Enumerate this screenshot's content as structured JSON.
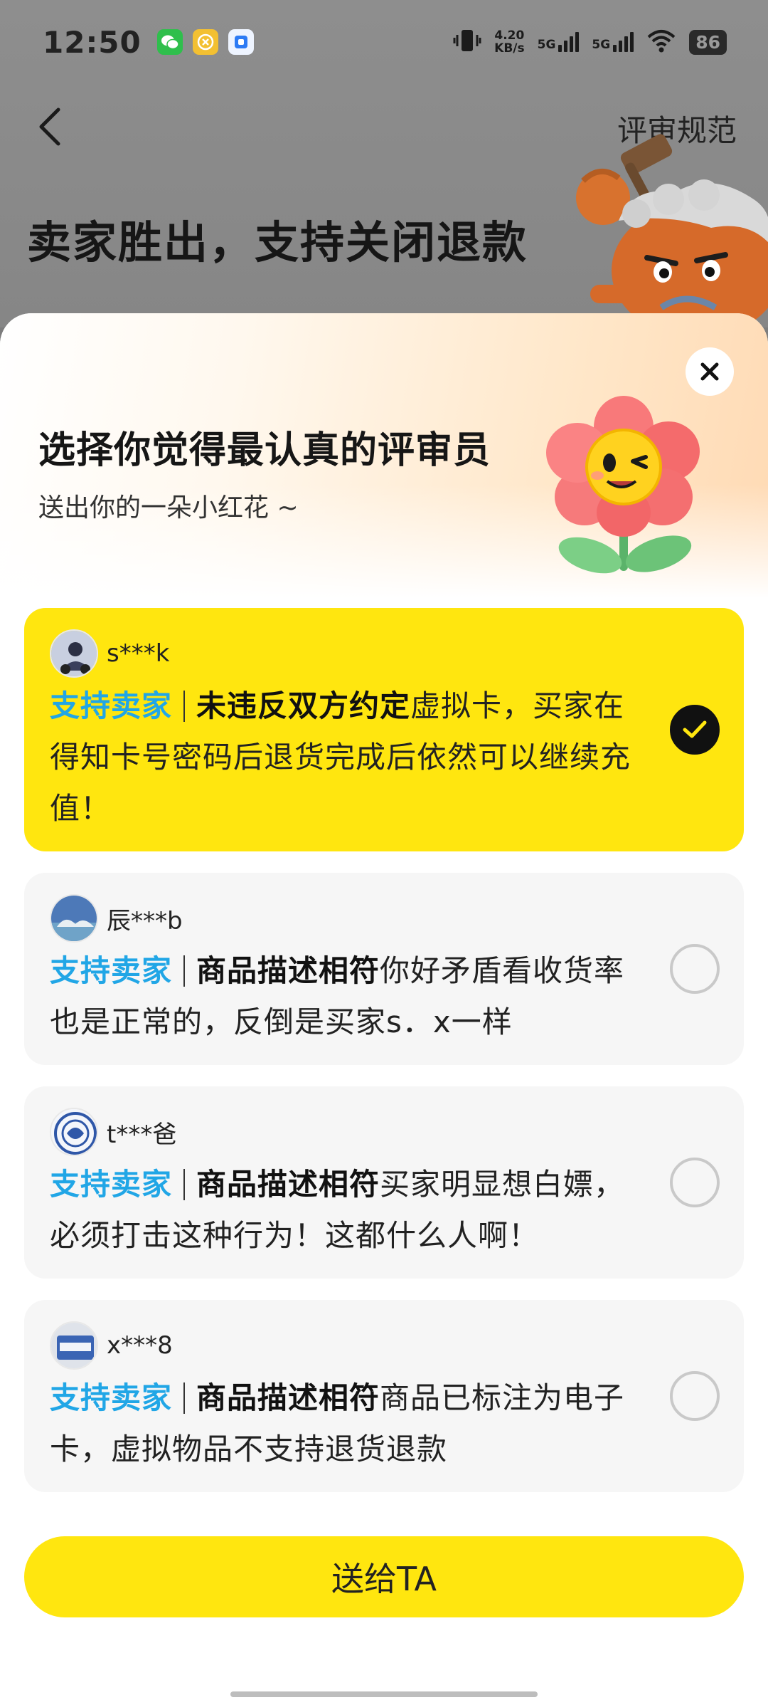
{
  "status_bar": {
    "time": "12:50",
    "net_speed_value": "4.20",
    "net_speed_unit": "KB/s",
    "signal_1": "5G",
    "signal_2": "5G",
    "battery": "86"
  },
  "header": {
    "rules_link": "评审规范",
    "verdict_title": "卖家胜出，支持关闭退款"
  },
  "sheet": {
    "title": "选择你觉得最认真的评审员",
    "subtitle": "送出你的一朵小红花 ~",
    "send_button": "送给TA"
  },
  "reviews": [
    {
      "name": "s***k",
      "stance": "支持卖家",
      "criterion": "未违反双方约定",
      "comment": "虚拟卡，买家在得知卡号密码后退货完成后依然可以继续充值！",
      "selected": true
    },
    {
      "name": "辰***b",
      "stance": "支持卖家",
      "criterion": "商品描述相符",
      "comment": "你好矛盾看收货率也是正常的，反倒是买家s．x一样",
      "selected": false
    },
    {
      "name": "t***爸",
      "stance": "支持卖家",
      "criterion": "商品描述相符",
      "comment": "买家明显想白嫖，必须打击这种行为！这都什么人啊！",
      "selected": false
    },
    {
      "name": "x***8",
      "stance": "支持卖家",
      "criterion": "商品描述相符",
      "comment": "商品已标注为电子卡，虚拟物品不支持退货退款",
      "selected": false
    }
  ],
  "colors": {
    "accent_yellow": "#ffe60f",
    "stance_blue": "#21a6e6",
    "overlay_gray": "#8a8a8a"
  },
  "icons": [
    "back-arrow-icon",
    "close-icon",
    "check-icon",
    "crab-judge-mascot",
    "flower-mascot"
  ]
}
